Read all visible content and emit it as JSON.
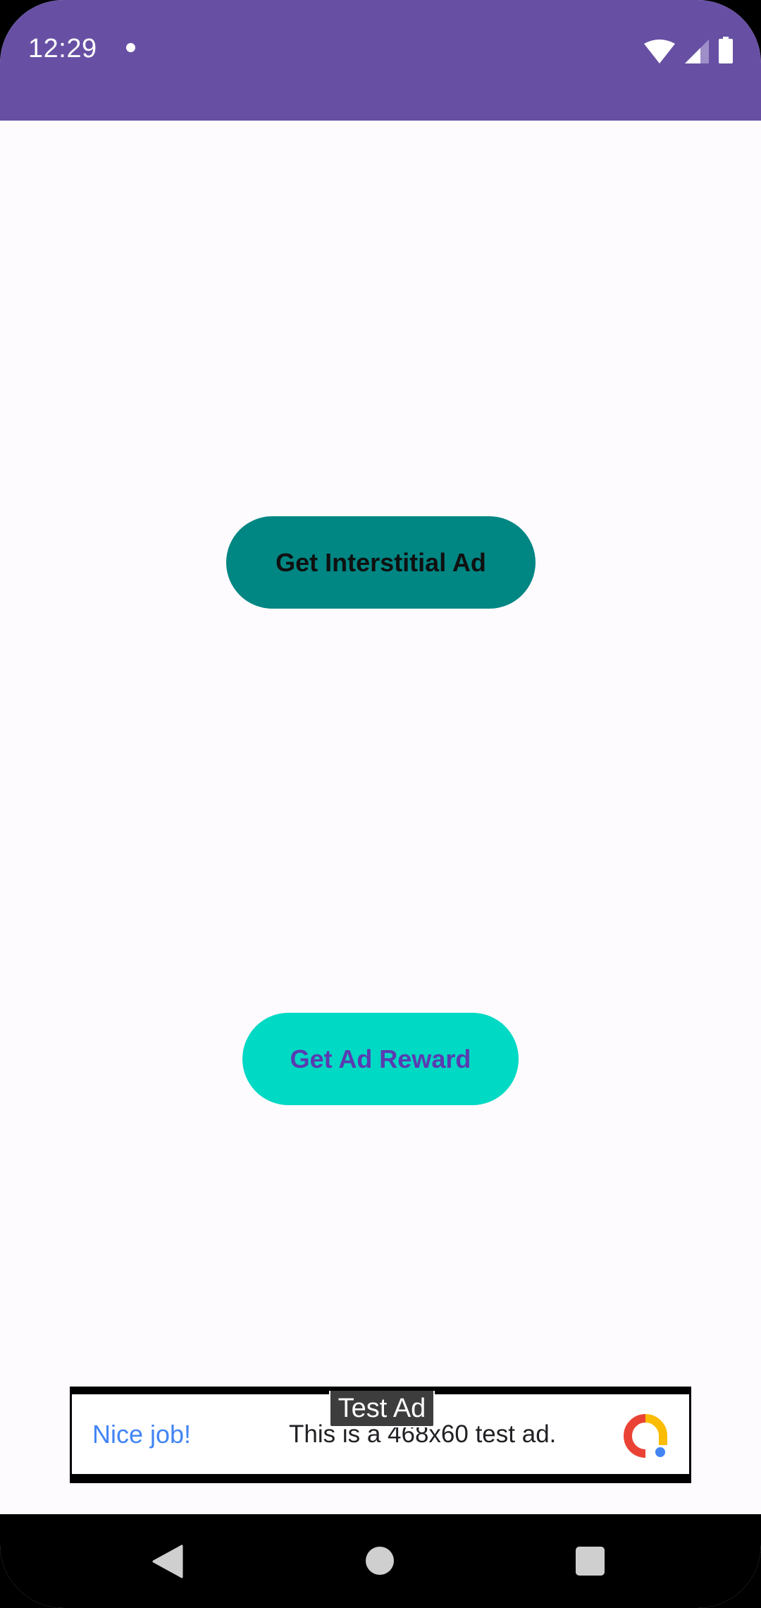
{
  "status_bar": {
    "time": "12:29",
    "background_color": "#6750a4",
    "icons": [
      "notification-dot-icon",
      "wifi-icon",
      "signal-icon",
      "battery-icon"
    ]
  },
  "main": {
    "interstitial_button_label": "Get Interstitial Ad",
    "reward_button_label": "Get Ad Reward",
    "interstitial_button_color": "#008683",
    "reward_button_color": "#00d9c4"
  },
  "ad_banner": {
    "label": "Test Ad",
    "headline": "Nice job!",
    "body": "This is a 468x60 test ad.",
    "logo_icon": "admob-logo-icon"
  },
  "nav_bar": {
    "icons": [
      "back-icon",
      "home-icon",
      "recents-icon"
    ]
  }
}
